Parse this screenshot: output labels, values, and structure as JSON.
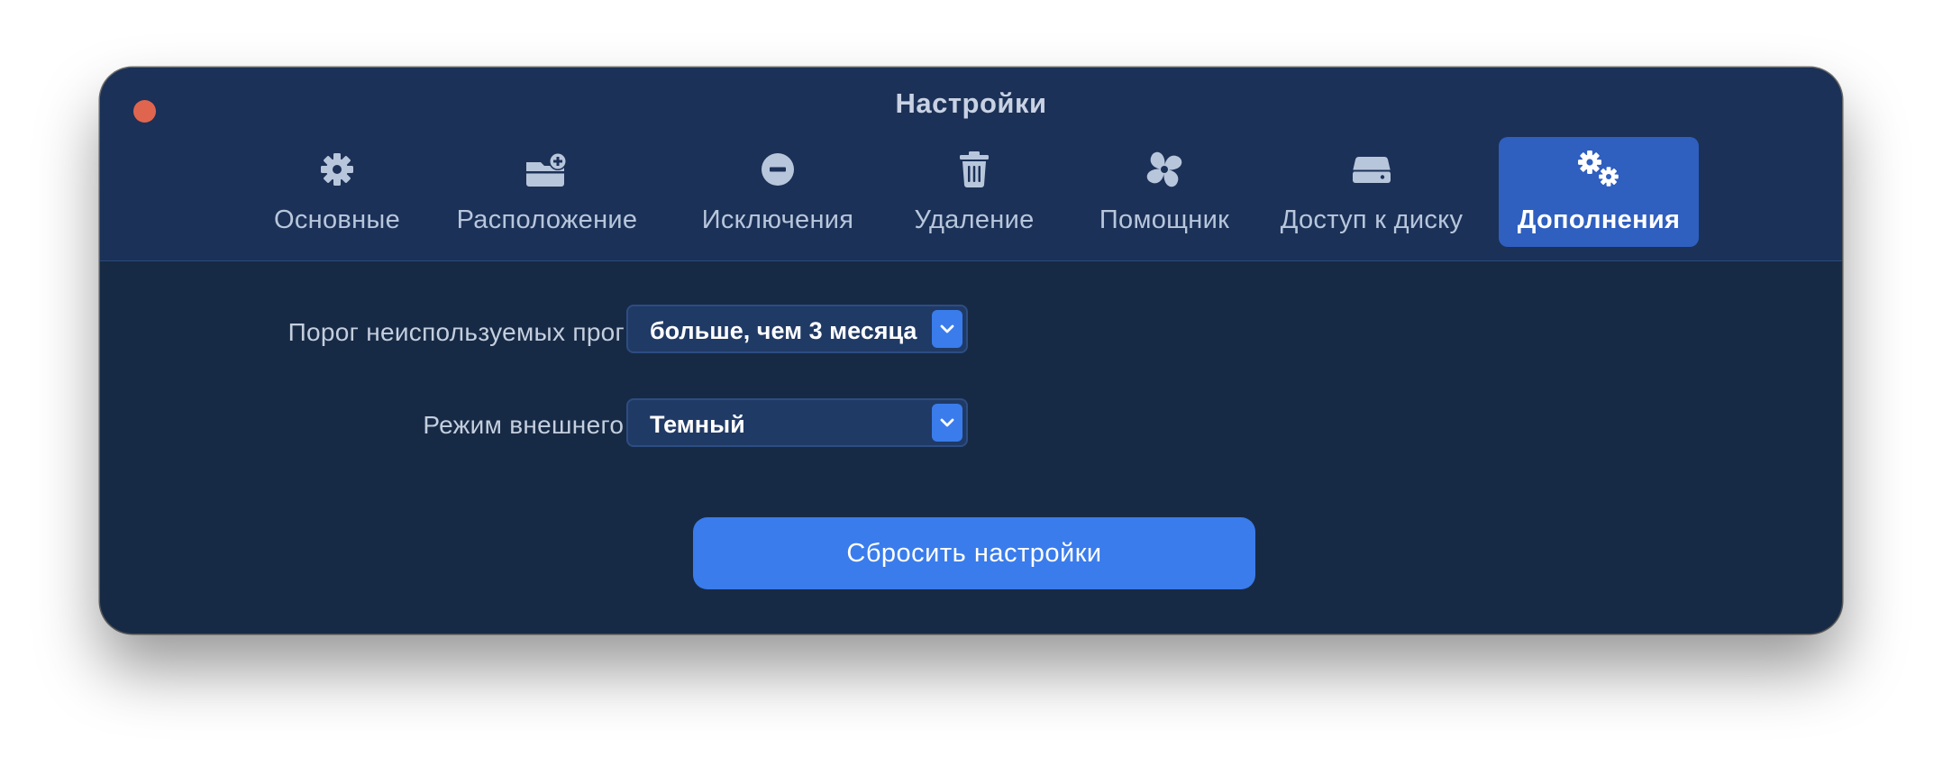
{
  "window": {
    "title": "Настройки"
  },
  "tabs": [
    {
      "label": "Основные",
      "icon": "gear-icon"
    },
    {
      "label": "Расположение",
      "icon": "folder-plus-icon"
    },
    {
      "label": "Исключения",
      "icon": "minus-circle-icon"
    },
    {
      "label": "Удаление",
      "icon": "trash-icon"
    },
    {
      "label": "Помощник",
      "icon": "assistant-swirl-icon"
    },
    {
      "label": "Доступ к диску",
      "icon": "drive-icon"
    },
    {
      "label": "Дополнения",
      "icon": "gears-icon",
      "selected": true
    }
  ],
  "settings": {
    "unused_threshold": {
      "label": "Порог неиспользуемых программ:",
      "value": "больше, чем 3 месяца"
    },
    "appearance": {
      "label": "Режим внешнего вида:",
      "value": "Темный"
    }
  },
  "reset_button": {
    "label": "Сбросить настройки"
  },
  "colors": {
    "window_bg": "#172a45",
    "toolbar_bg": "#1b3157",
    "selected_tab": "#2f5fbf",
    "accent": "#3a7ceb",
    "close_button": "#e0654f"
  }
}
